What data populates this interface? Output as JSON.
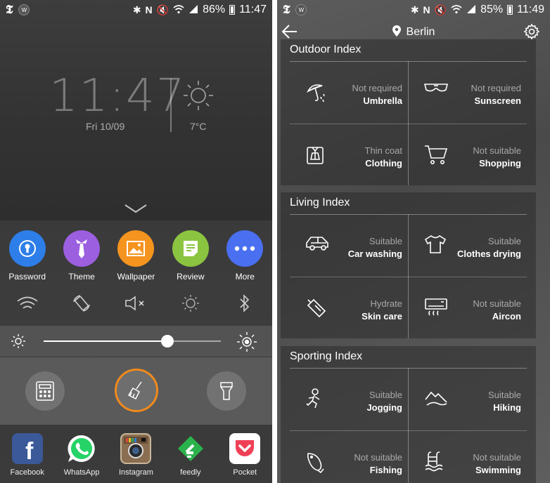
{
  "left": {
    "status": {
      "time": "11:47",
      "battery": "86%"
    },
    "clock": {
      "time": "11:47",
      "date": "Fri 10/09",
      "temp": "7°C"
    },
    "quick_apps": [
      {
        "label": "Password",
        "color": "#2d7ee8",
        "icon": "keyhole-icon"
      },
      {
        "label": "Theme",
        "color": "#9c5fe0",
        "icon": "tie-icon"
      },
      {
        "label": "Wallpaper",
        "color": "#f5941f",
        "icon": "image-icon"
      },
      {
        "label": "Review",
        "color": "#8bc440",
        "icon": "note-icon"
      },
      {
        "label": "More",
        "color": "#4a6ff0",
        "icon": "dots-icon"
      }
    ],
    "brightness": 0.7,
    "dock": [
      {
        "label": "Facebook",
        "icon": "facebook-icon",
        "color": "#3b5998"
      },
      {
        "label": "WhatsApp",
        "icon": "whatsapp-icon",
        "color": "#25d366"
      },
      {
        "label": "Instagram",
        "icon": "instagram-icon",
        "color": "#8a6e52"
      },
      {
        "label": "feedly",
        "icon": "feedly-icon",
        "color": "#2bb24c"
      },
      {
        "label": "Pocket",
        "icon": "pocket-icon",
        "color": "#ef4056"
      }
    ]
  },
  "right": {
    "status": {
      "time": "11:49",
      "battery": "85%"
    },
    "city": "Berlin",
    "sections": [
      {
        "title": "Outdoor Index",
        "items": [
          {
            "state": "Not required",
            "name": "Umbrella",
            "icon": "umbrella-icon"
          },
          {
            "state": "Not required",
            "name": "Sunscreen",
            "icon": "sunglasses-icon"
          },
          {
            "state": "Thin coat",
            "name": "Clothing",
            "icon": "coat-icon"
          },
          {
            "state": "Not suitable",
            "name": "Shopping",
            "icon": "cart-icon"
          }
        ]
      },
      {
        "title": "Living Index",
        "items": [
          {
            "state": "Suitable",
            "name": "Car washing",
            "icon": "car-icon"
          },
          {
            "state": "Suitable",
            "name": "Clothes drying",
            "icon": "shirt-icon"
          },
          {
            "state": "Hydrate",
            "name": "Skin care",
            "icon": "lotion-icon"
          },
          {
            "state": "Not suitable",
            "name": "Aircon",
            "icon": "aircon-icon"
          }
        ]
      },
      {
        "title": "Sporting Index",
        "items": [
          {
            "state": "Suitable",
            "name": "Jogging",
            "icon": "runner-icon"
          },
          {
            "state": "Suitable",
            "name": "Hiking",
            "icon": "mountain-icon"
          },
          {
            "state": "Not suitable",
            "name": "Fishing",
            "icon": "fish-icon"
          },
          {
            "state": "Not suitable",
            "name": "Swimming",
            "icon": "swimming-icon"
          }
        ]
      }
    ]
  }
}
